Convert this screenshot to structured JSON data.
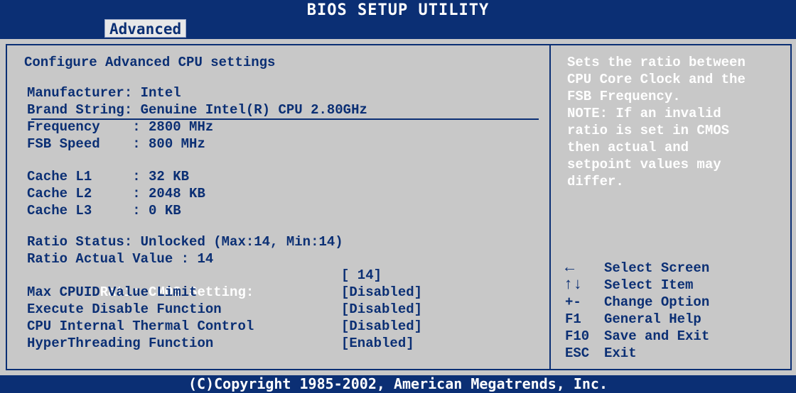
{
  "header": {
    "title": "BIOS SETUP UTILITY",
    "tab": "Advanced"
  },
  "left": {
    "heading": "Configure Advanced CPU settings",
    "cpu_info": {
      "manufacturer": "Manufacturer: Intel",
      "brand": "Brand String: Genuine Intel(R) CPU 2.80GHz",
      "frequency": "Frequency    : 2800 MHz",
      "fsb": "FSB Speed    : 800 MHz"
    },
    "cache": {
      "l1": "Cache L1     : 32 KB",
      "l2": "Cache L2     : 2048 KB",
      "l3": "Cache L3     : 0 KB"
    },
    "ratio": {
      "status": "Ratio Status: Unlocked (Max:14, Min:14)",
      "actual": "Ratio Actual Value : 14"
    },
    "settings": [
      {
        "label": "   Ratio CMOS Setting:",
        "value": "[ 14]"
      },
      {
        "label": "Max CPUID Value Limit",
        "value": "[Disabled]"
      },
      {
        "label": "Execute Disable Function",
        "value": "[Disabled]"
      },
      {
        "label": "CPU Internal Thermal Control",
        "value": "[Disabled]"
      },
      {
        "label": "HyperThreading Function",
        "value": "[Enabled]"
      }
    ]
  },
  "right": {
    "help_lines": [
      "Sets the ratio between",
      "CPU Core Clock and the",
      "FSB Frequency.",
      "NOTE: If an invalid",
      "ratio is set in CMOS",
      "then actual and",
      "setpoint values may",
      "differ."
    ],
    "keys": [
      {
        "key": "←",
        "desc": "Select Screen",
        "icon": "left-arrow-icon"
      },
      {
        "key": "↑↓",
        "desc": "Select Item",
        "icon": "up-down-arrows-icon"
      },
      {
        "key": "+-",
        "desc": "Change Option",
        "icon": ""
      },
      {
        "key": "F1",
        "desc": "General Help",
        "icon": ""
      },
      {
        "key": "F10",
        "desc": "Save and Exit",
        "icon": ""
      },
      {
        "key": "ESC",
        "desc": "Exit",
        "icon": ""
      }
    ]
  },
  "footer": {
    "copyright": "(C)Copyright 1985-2002, American Megatrends, Inc."
  },
  "colors": {
    "bg": "#c8c8c8",
    "bar": "#0b2f74",
    "text": "#0b2f74",
    "highlight": "#ffffff"
  }
}
